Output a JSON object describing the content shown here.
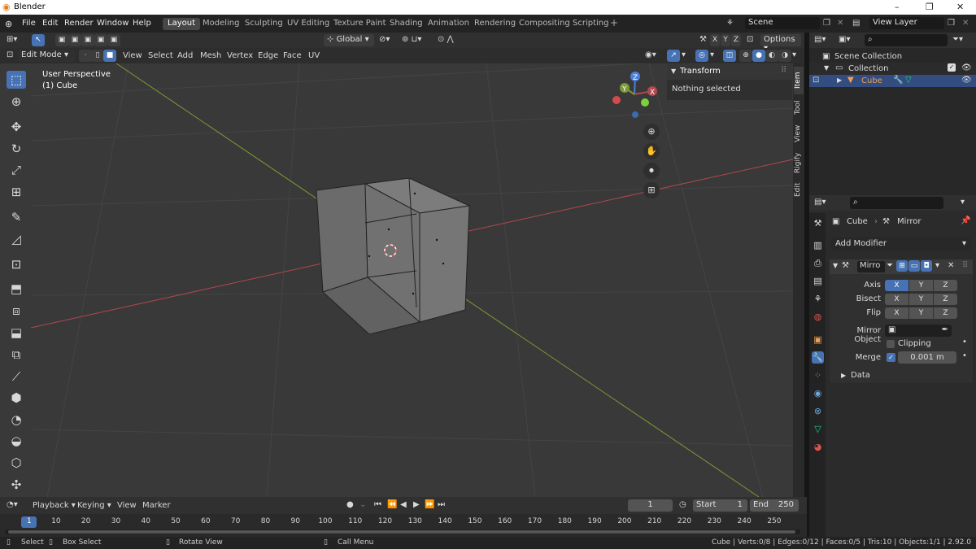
{
  "window": {
    "title": "Blender",
    "controls": [
      "–",
      "❐",
      "✕"
    ]
  },
  "menu": [
    "File",
    "Edit",
    "Render",
    "Window",
    "Help"
  ],
  "workspaces": [
    "Layout",
    "Modeling",
    "Sculpting",
    "UV Editing",
    "Texture Paint",
    "Shading",
    "Animation",
    "Rendering",
    "Compositing",
    "Scripting"
  ],
  "active_workspace": "Layout",
  "scene": {
    "label": "Scene",
    "view_layer": "View Layer"
  },
  "header": {
    "transform_orientation": "Global",
    "options_label": "Options",
    "axes": [
      "X",
      "Y",
      "Z"
    ],
    "mode": "Edit Mode",
    "menus": [
      "View",
      "Select",
      "Add",
      "Mesh",
      "Vertex",
      "Edge",
      "Face",
      "UV"
    ]
  },
  "viewport": {
    "perspective": "User Perspective",
    "object": "(1) Cube",
    "gizmo": {
      "x": "X",
      "y": "Y",
      "z": "Z"
    },
    "colors": {
      "background": "#393939",
      "x_axis": "#b2474f",
      "y_axis": "#7c9a35",
      "z_axis": "#4a7fdc"
    }
  },
  "npanel": {
    "title": "Transform",
    "message": "Nothing selected",
    "tabs": [
      "Item",
      "Tool",
      "View",
      "Rigify",
      "Edit"
    ]
  },
  "outliner": {
    "root": "Scene Collection",
    "collection": "Collection",
    "object": "Cube"
  },
  "properties": {
    "breadcrumb_object": "Cube",
    "breadcrumb_modifier": "Mirror",
    "add_modifier": "Add Modifier",
    "modifier_name": "Mirro",
    "rows": [
      {
        "label": "Axis",
        "values": [
          "X",
          "Y",
          "Z"
        ],
        "active": [
          true,
          false,
          false
        ]
      },
      {
        "label": "Bisect",
        "values": [
          "X",
          "Y",
          "Z"
        ],
        "active": [
          false,
          false,
          false
        ]
      },
      {
        "label": "Flip",
        "values": [
          "X",
          "Y",
          "Z"
        ],
        "active": [
          false,
          false,
          false
        ]
      }
    ],
    "mirror_object_label": "Mirror Object",
    "clipping_label": "Clipping",
    "clipping": false,
    "merge_label": "Merge",
    "merge": true,
    "merge_value": "0.001 m",
    "data_label": "Data"
  },
  "timeline": {
    "menus": [
      "Playback",
      "Keying",
      "View",
      "Marker"
    ],
    "current_frame": "1",
    "start_label": "Start",
    "start": "1",
    "end_label": "End",
    "end": "250",
    "ticks": [
      "1",
      "10",
      "20",
      "30",
      "40",
      "50",
      "60",
      "70",
      "80",
      "90",
      "100",
      "110",
      "120",
      "130",
      "140",
      "150",
      "160",
      "170",
      "180",
      "190",
      "200",
      "210",
      "220",
      "230",
      "240",
      "250"
    ]
  },
  "status": {
    "select": "Select",
    "box_select": "Box Select",
    "rotate_view": "Rotate View",
    "call_menu": "Call Menu",
    "stats": "Cube | Verts:0/8 | Edges:0/12 | Faces:0/5 | Tris:10 | Objects:1/1 | 2.92.0"
  },
  "accent_color": "#4772b3"
}
